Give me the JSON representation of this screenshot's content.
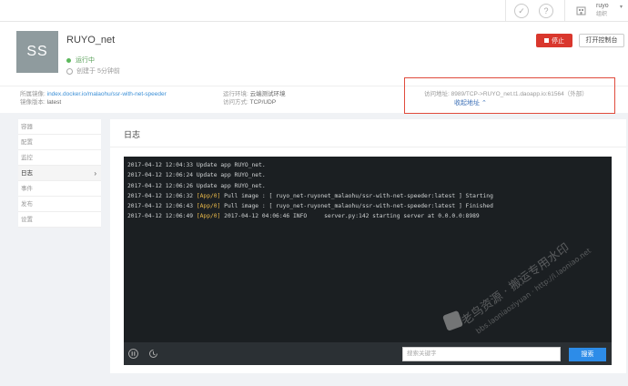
{
  "topbar": {
    "org_name": "ruyo",
    "org_sub": "组织"
  },
  "header": {
    "avatar_initials": "SS",
    "app_name": "RUYO_net",
    "status": "运行中",
    "created": "创建于 5分钟前",
    "stop_label": "停止",
    "console_label": "打开控制台"
  },
  "info": {
    "image_label": "所属镜像:",
    "image_value": "index.docker.io/malaohu/ssr-with-net-speeder",
    "image_version_label": "镜像版本:",
    "image_version_value": "latest",
    "env_label": "运行环境:",
    "env_value": "云端测试环境",
    "access_mode_label": "访问方式:",
    "access_mode_value": "TCP/UDP",
    "access_addr_label": "访问地址:",
    "access_addr_value": "8989/TCP->RUYO_net.t1.daoapp.io:61564（外部）",
    "collapse_label": "收起地址 ⌃"
  },
  "sidebar": {
    "items": [
      {
        "label": "容器"
      },
      {
        "label": "配置"
      },
      {
        "label": "监控"
      },
      {
        "label": "日志"
      },
      {
        "label": "事件"
      },
      {
        "label": "发布"
      },
      {
        "label": "设置"
      }
    ]
  },
  "main": {
    "title": "日志"
  },
  "logs": [
    {
      "time": "2017-04-12 12:04:33",
      "tag": "",
      "msg": "Update app RUYO_net."
    },
    {
      "time": "2017-04-12 12:06:24",
      "tag": "",
      "msg": "Update app RUYO_net."
    },
    {
      "time": "2017-04-12 12:06:26",
      "tag": "",
      "msg": "Update app RUYO_net."
    },
    {
      "time": "2017-04-12 12:06:32",
      "tag": "[App/0]",
      "msg": "Pull image : [ ruyo_net-ruyonet_malaohu/ssr-with-net-speeder:latest ] Starting"
    },
    {
      "time": "2017-04-12 12:06:43",
      "tag": "[App/0]",
      "msg": "Pull image : [ ruyo_net-ruyonet_malaohu/ssr-with-net-speeder:latest ] Finished"
    },
    {
      "time": "2017-04-12 12:06:49",
      "tag": "[App/0]",
      "msg": "2017-04-12 04:06:46 INFO     server.py:142 starting server at 0.0.0.0:8989"
    }
  ],
  "search": {
    "placeholder": "搜索关键字",
    "button_label": "搜索"
  },
  "watermark": {
    "line1": "老鸟资源 · 搬运专用水印",
    "line2": "bbs.laoniaoziyuan · http://i.laoniao.net"
  },
  "colors": {
    "stop": "#d9372d",
    "search": "#2d8ce8",
    "highlight": "#e04b3c"
  }
}
